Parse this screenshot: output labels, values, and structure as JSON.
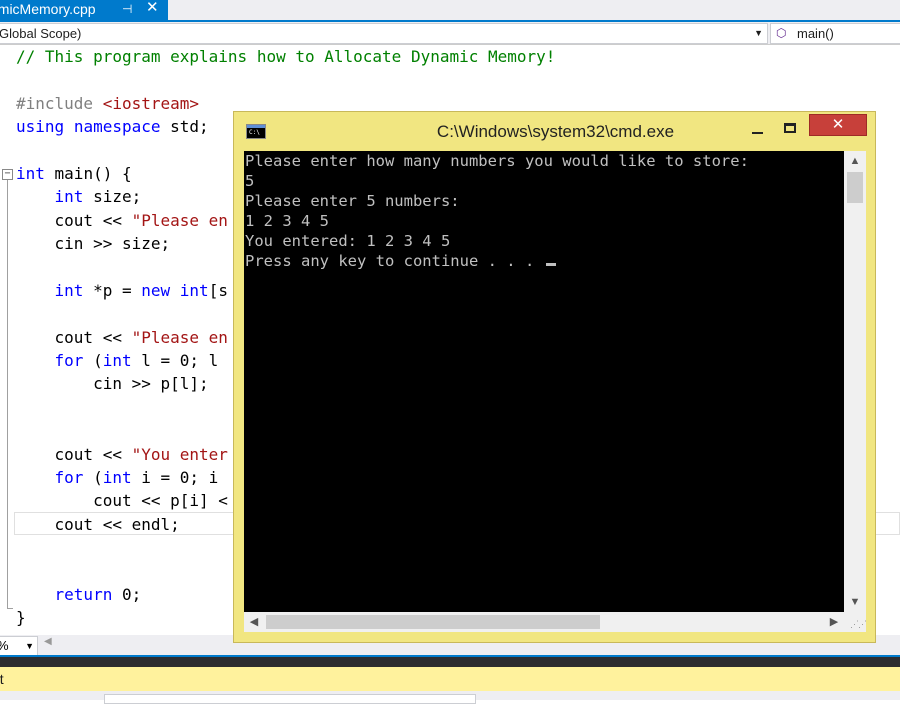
{
  "ide": {
    "tab": {
      "title": "amicMemory.cpp",
      "pin_glyph": "⊣",
      "close_glyph": "✕"
    },
    "scope": {
      "value": "Global Scope)"
    },
    "function": {
      "value": "main()"
    },
    "zoom": {
      "value": "%"
    },
    "output": {
      "title": "ut"
    },
    "code_lines": [
      [
        [
          "cm",
          "// This program explains how to Allocate Dynamic Memory!"
        ]
      ],
      [],
      [
        [
          "pp",
          "#include "
        ],
        [
          "str",
          "<iostream>"
        ]
      ],
      [
        [
          "kw",
          "using"
        ],
        [
          "",
          " "
        ],
        [
          "kw",
          "namespace"
        ],
        [
          "",
          " std;"
        ]
      ],
      [],
      [
        [
          "kw",
          "int"
        ],
        [
          "",
          " main() {"
        ]
      ],
      [
        [
          "",
          "    "
        ],
        [
          "kw",
          "int"
        ],
        [
          "",
          " size;"
        ]
      ],
      [
        [
          "",
          "    cout << "
        ],
        [
          "str",
          "\"Please en"
        ]
      ],
      [
        [
          "",
          "    cin >> size;"
        ]
      ],
      [],
      [
        [
          "",
          "    "
        ],
        [
          "kw",
          "int"
        ],
        [
          "",
          " *p = "
        ],
        [
          "kw",
          "new"
        ],
        [
          "",
          " "
        ],
        [
          "kw",
          "int"
        ],
        [
          "",
          "[s"
        ]
      ],
      [],
      [
        [
          "",
          "    cout << "
        ],
        [
          "str",
          "\"Please en"
        ]
      ],
      [
        [
          "",
          "    "
        ],
        [
          "kw",
          "for"
        ],
        [
          "",
          " ("
        ],
        [
          "kw",
          "int"
        ],
        [
          "",
          " l = 0; l"
        ]
      ],
      [
        [
          "",
          "        cin >> p[l];"
        ]
      ],
      [],
      [],
      [
        [
          "",
          "    cout << "
        ],
        [
          "str",
          "\"You enter"
        ]
      ],
      [
        [
          "",
          "    "
        ],
        [
          "kw",
          "for"
        ],
        [
          "",
          " ("
        ],
        [
          "kw",
          "int"
        ],
        [
          "",
          " i = 0; i"
        ]
      ],
      [
        [
          "",
          "        cout << p[i] <"
        ]
      ],
      [
        [
          "",
          "    cout << endl;"
        ]
      ],
      [],
      [],
      [
        [
          "",
          "    "
        ],
        [
          "kw",
          "return"
        ],
        [
          "",
          " 0;"
        ]
      ],
      [
        [
          "",
          "}"
        ]
      ]
    ]
  },
  "cmd": {
    "title": "C:\\Windows\\system32\\cmd.exe",
    "icon_text": "C:\\",
    "close_glyph": "✕",
    "lines": [
      "Please enter how many numbers you would like to store:",
      "5",
      "Please enter 5 numbers:",
      "1 2 3 4 5",
      "You entered: 1 2 3 4 5",
      "Press any key to continue . . . "
    ]
  },
  "colors": {
    "accent": "#007acc",
    "cmd_frame": "#f1e681",
    "close_button": "#c7403a",
    "console_bg": "#000000",
    "console_fg": "#c0c0c0"
  },
  "icons": {
    "function": "cube-icon",
    "dropdown": "chevron-down-icon"
  }
}
